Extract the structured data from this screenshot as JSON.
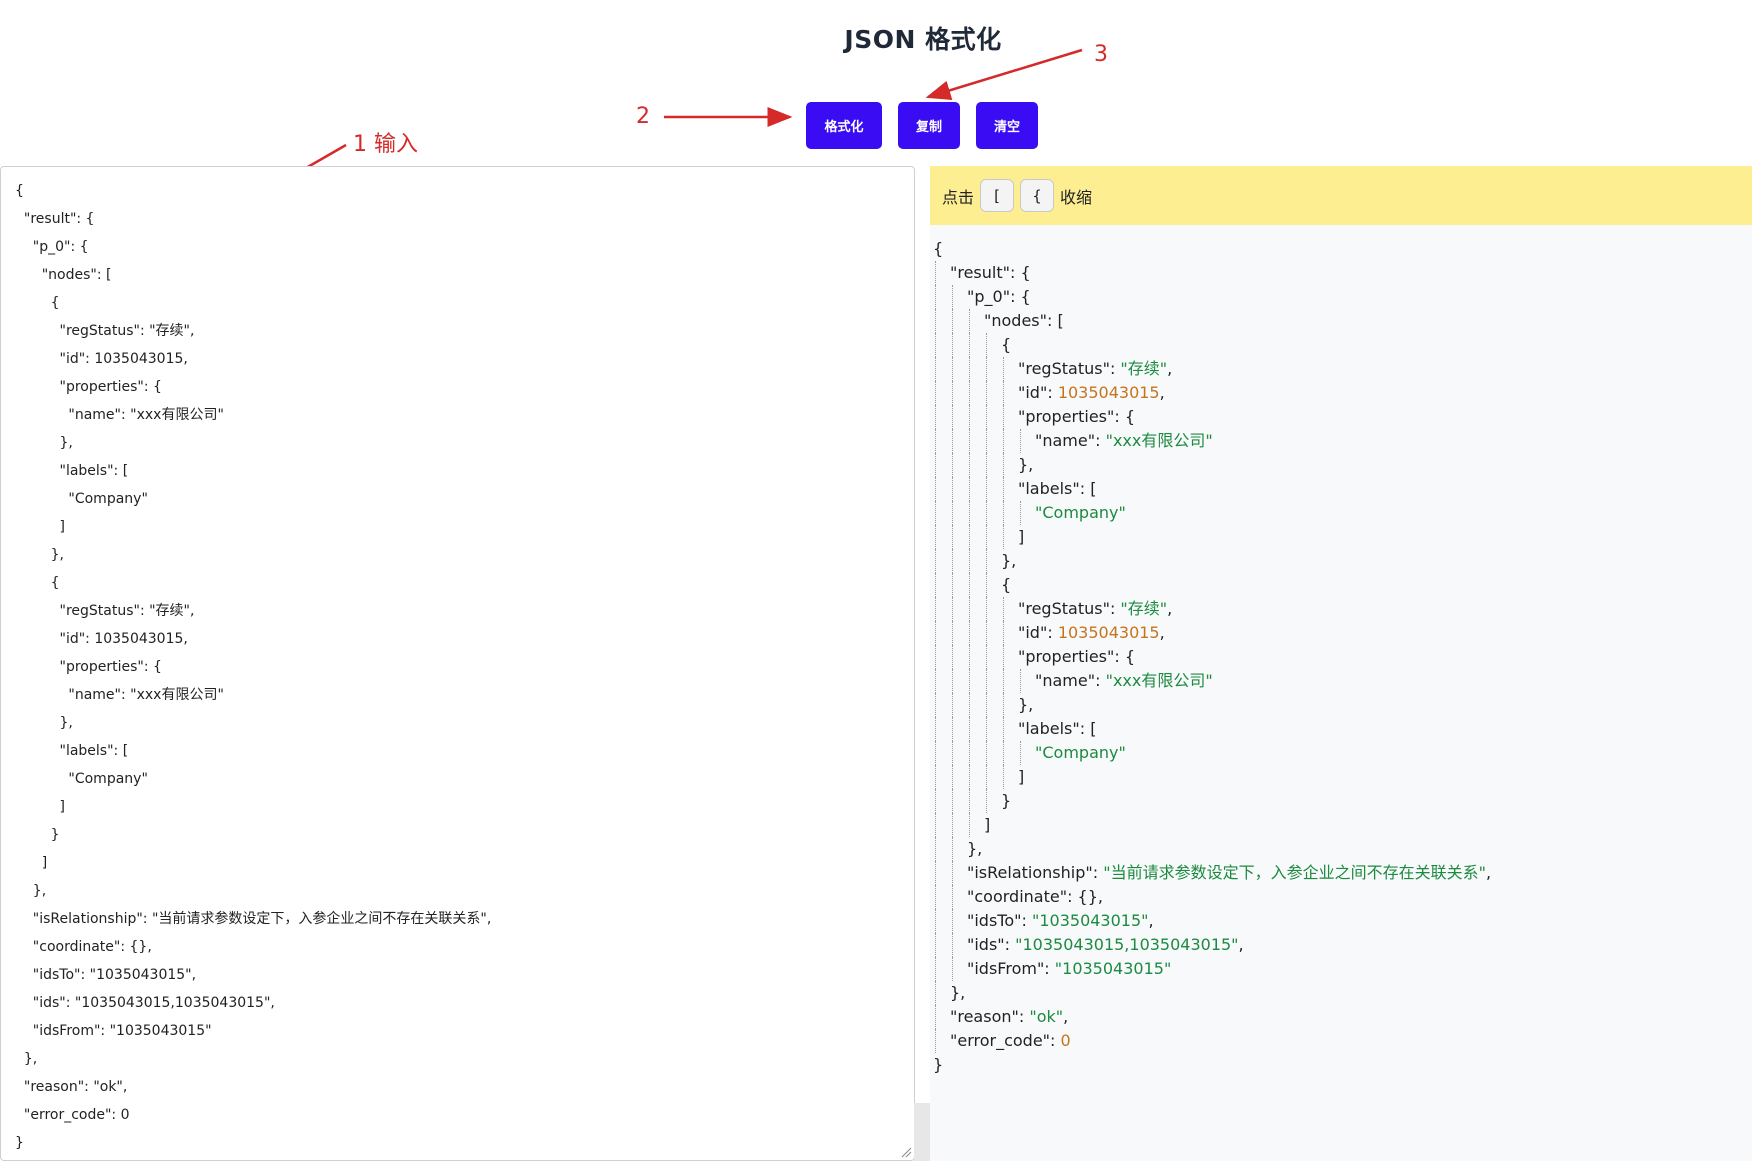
{
  "page": {
    "title": "JSON 格式化"
  },
  "toolbar": {
    "format_label": "格式化",
    "copy_label": "复制",
    "clear_label": "清空"
  },
  "annotations": {
    "a1": "1 输入",
    "a2": "2",
    "a3": "3"
  },
  "input": {
    "lines": [
      "{",
      "  \"result\": {",
      "    \"p_0\": {",
      "      \"nodes\": [",
      "        {",
      "          \"regStatus\": \"存续\",",
      "          \"id\": 1035043015,",
      "          \"properties\": {",
      "            \"name\": \"xxx有限公司\"",
      "          },",
      "          \"labels\": [",
      "            \"Company\"",
      "          ]",
      "        },",
      "        {",
      "          \"regStatus\": \"存续\",",
      "          \"id\": 1035043015,",
      "          \"properties\": {",
      "            \"name\": \"xxx有限公司\"",
      "          },",
      "          \"labels\": [",
      "            \"Company\"",
      "          ]",
      "        }",
      "      ]",
      "    },",
      "    \"isRelationship\": \"当前请求参数设定下，入参企业之间不存在关联关系\",",
      "    \"coordinate\": {},",
      "    \"idsTo\": \"1035043015\",",
      "    \"ids\": \"1035043015,1035043015\",",
      "    \"idsFrom\": \"1035043015\"",
      "  },",
      "  \"reason\": \"ok\",",
      "  \"error_code\": 0",
      "}"
    ]
  },
  "tip": {
    "prefix": "点击",
    "key1": "[",
    "key2": "{",
    "suffix": "收缩"
  },
  "output": {
    "lines": [
      {
        "depth": 0,
        "parts": [
          [
            "p",
            "{"
          ]
        ]
      },
      {
        "depth": 1,
        "parts": [
          [
            "k",
            "\"result\""
          ],
          [
            "p",
            ": {"
          ]
        ]
      },
      {
        "depth": 2,
        "parts": [
          [
            "k",
            "\"p_0\""
          ],
          [
            "p",
            ": {"
          ]
        ]
      },
      {
        "depth": 3,
        "parts": [
          [
            "k",
            "\"nodes\""
          ],
          [
            "p",
            ": ["
          ]
        ]
      },
      {
        "depth": 4,
        "parts": [
          [
            "p",
            "{"
          ]
        ]
      },
      {
        "depth": 5,
        "parts": [
          [
            "k",
            "\"regStatus\""
          ],
          [
            "p",
            ": "
          ],
          [
            "s",
            "\"存续\""
          ],
          [
            "p",
            ","
          ]
        ]
      },
      {
        "depth": 5,
        "parts": [
          [
            "k",
            "\"id\""
          ],
          [
            "p",
            ": "
          ],
          [
            "n",
            "1035043015"
          ],
          [
            "p",
            ","
          ]
        ]
      },
      {
        "depth": 5,
        "parts": [
          [
            "k",
            "\"properties\""
          ],
          [
            "p",
            ": {"
          ]
        ]
      },
      {
        "depth": 6,
        "parts": [
          [
            "k",
            "\"name\""
          ],
          [
            "p",
            ": "
          ],
          [
            "s",
            "\"xxx有限公司\""
          ]
        ]
      },
      {
        "depth": 5,
        "parts": [
          [
            "p",
            "},"
          ]
        ]
      },
      {
        "depth": 5,
        "parts": [
          [
            "k",
            "\"labels\""
          ],
          [
            "p",
            ": ["
          ]
        ]
      },
      {
        "depth": 6,
        "parts": [
          [
            "s",
            "\"Company\""
          ]
        ]
      },
      {
        "depth": 5,
        "parts": [
          [
            "p",
            "]"
          ]
        ]
      },
      {
        "depth": 4,
        "parts": [
          [
            "p",
            "},"
          ]
        ]
      },
      {
        "depth": 4,
        "parts": [
          [
            "p",
            "{"
          ]
        ]
      },
      {
        "depth": 5,
        "parts": [
          [
            "k",
            "\"regStatus\""
          ],
          [
            "p",
            ": "
          ],
          [
            "s",
            "\"存续\""
          ],
          [
            "p",
            ","
          ]
        ]
      },
      {
        "depth": 5,
        "parts": [
          [
            "k",
            "\"id\""
          ],
          [
            "p",
            ": "
          ],
          [
            "n",
            "1035043015"
          ],
          [
            "p",
            ","
          ]
        ]
      },
      {
        "depth": 5,
        "parts": [
          [
            "k",
            "\"properties\""
          ],
          [
            "p",
            ": {"
          ]
        ]
      },
      {
        "depth": 6,
        "parts": [
          [
            "k",
            "\"name\""
          ],
          [
            "p",
            ": "
          ],
          [
            "s",
            "\"xxx有限公司\""
          ]
        ]
      },
      {
        "depth": 5,
        "parts": [
          [
            "p",
            "},"
          ]
        ]
      },
      {
        "depth": 5,
        "parts": [
          [
            "k",
            "\"labels\""
          ],
          [
            "p",
            ": ["
          ]
        ]
      },
      {
        "depth": 6,
        "parts": [
          [
            "s",
            "\"Company\""
          ]
        ]
      },
      {
        "depth": 5,
        "parts": [
          [
            "p",
            "]"
          ]
        ]
      },
      {
        "depth": 4,
        "parts": [
          [
            "p",
            "}"
          ]
        ]
      },
      {
        "depth": 3,
        "parts": [
          [
            "p",
            "]"
          ]
        ]
      },
      {
        "depth": 2,
        "parts": [
          [
            "p",
            "},"
          ]
        ]
      },
      {
        "depth": 2,
        "parts": [
          [
            "k",
            "\"isRelationship\""
          ],
          [
            "p",
            ": "
          ],
          [
            "s",
            "\"当前请求参数设定下，入参企业之间不存在关联关系\""
          ],
          [
            "p",
            ","
          ]
        ]
      },
      {
        "depth": 2,
        "parts": [
          [
            "k",
            "\"coordinate\""
          ],
          [
            "p",
            ": {},"
          ]
        ]
      },
      {
        "depth": 2,
        "parts": [
          [
            "k",
            "\"idsTo\""
          ],
          [
            "p",
            ": "
          ],
          [
            "s",
            "\"1035043015\""
          ],
          [
            "p",
            ","
          ]
        ]
      },
      {
        "depth": 2,
        "parts": [
          [
            "k",
            "\"ids\""
          ],
          [
            "p",
            ": "
          ],
          [
            "s",
            "\"1035043015,1035043015\""
          ],
          [
            "p",
            ","
          ]
        ]
      },
      {
        "depth": 2,
        "parts": [
          [
            "k",
            "\"idsFrom\""
          ],
          [
            "p",
            ": "
          ],
          [
            "s",
            "\"1035043015\""
          ]
        ]
      },
      {
        "depth": 1,
        "parts": [
          [
            "p",
            "},"
          ]
        ]
      },
      {
        "depth": 1,
        "parts": [
          [
            "k",
            "\"reason\""
          ],
          [
            "p",
            ": "
          ],
          [
            "s",
            "\"ok\""
          ],
          [
            "p",
            ","
          ]
        ]
      },
      {
        "depth": 1,
        "parts": [
          [
            "k",
            "\"error_code\""
          ],
          [
            "p",
            ": "
          ],
          [
            "n",
            "0"
          ]
        ]
      },
      {
        "depth": 0,
        "parts": [
          [
            "p",
            "}"
          ]
        ]
      }
    ]
  },
  "colors": {
    "button": "#3a0cf3",
    "tip_bg": "#fdee92",
    "string": "#1c8a3f",
    "number": "#c7731b",
    "annotation": "#d42a2a"
  }
}
